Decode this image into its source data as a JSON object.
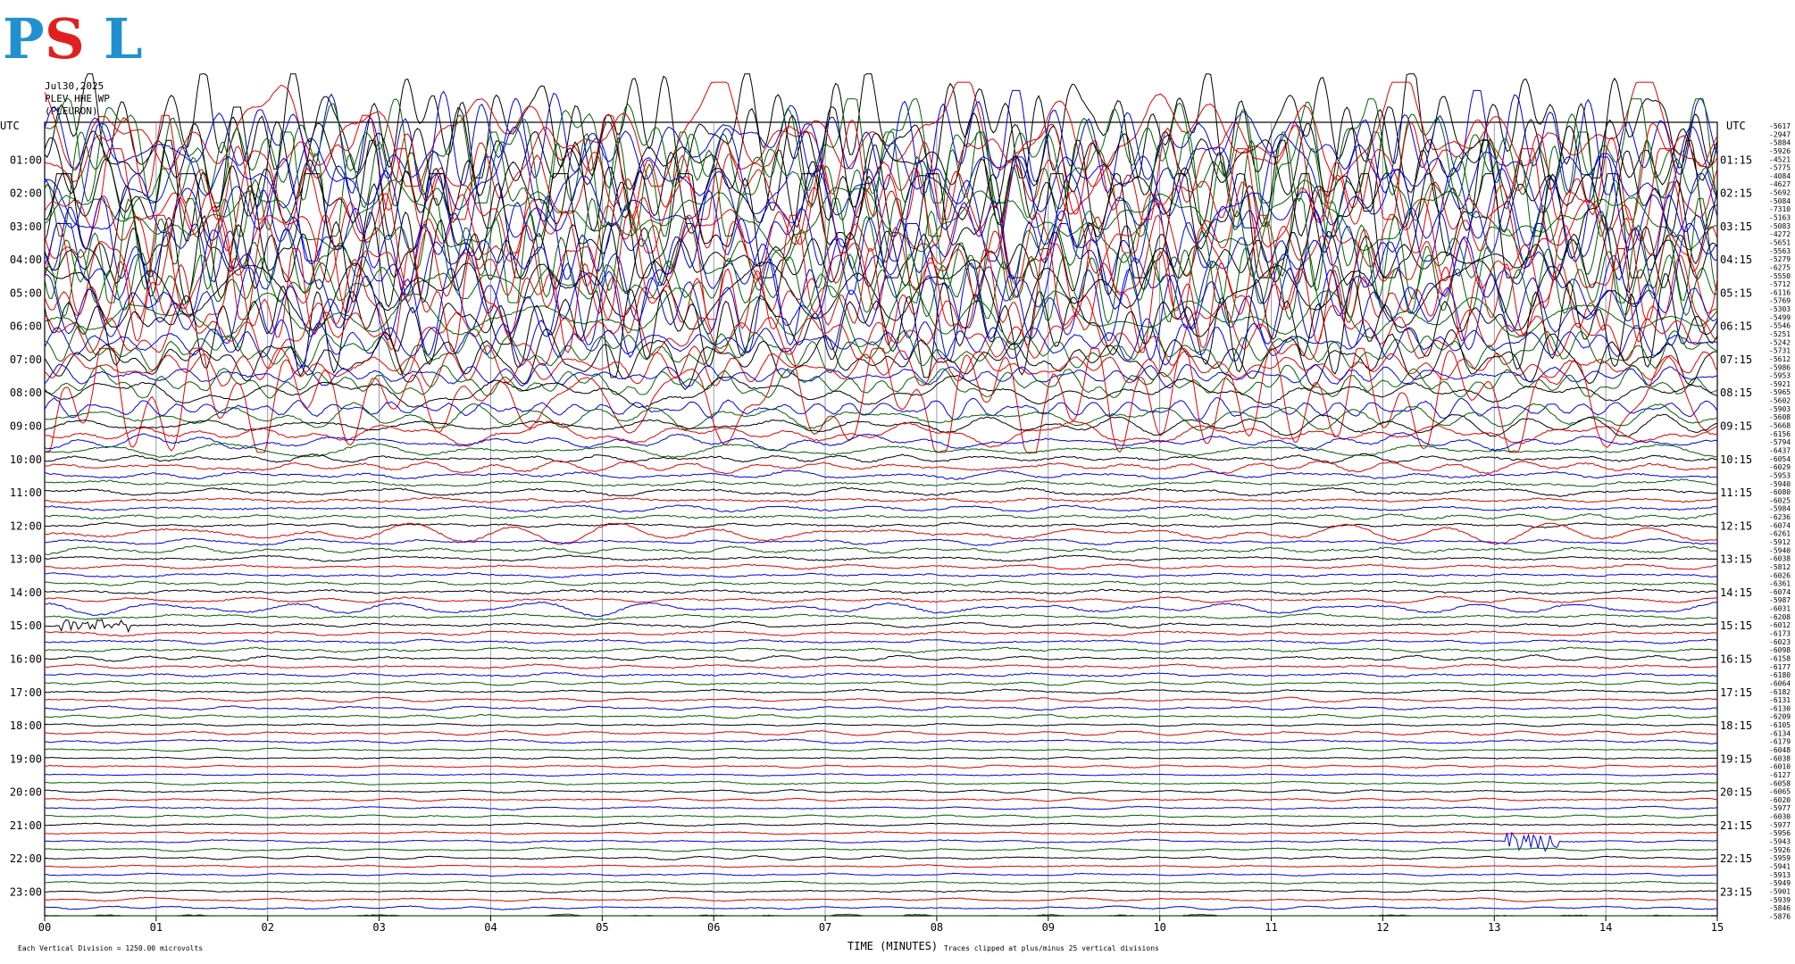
{
  "header": {
    "logo_text": "PSL",
    "date": "Jul30,2025",
    "station": "PLEV HHE WP",
    "site": "(PLEURON)"
  },
  "axes": {
    "left_tz": "UTC",
    "right_tz": "UTC",
    "xlabel": "TIME (MINUTES)",
    "x_ticks": [
      "00",
      "01",
      "02",
      "03",
      "04",
      "05",
      "06",
      "07",
      "08",
      "09",
      "10",
      "11",
      "12",
      "13",
      "14",
      "15"
    ],
    "left_hour_labels": [
      "01:00",
      "02:00",
      "03:00",
      "04:00",
      "05:00",
      "06:00",
      "07:00",
      "08:00",
      "09:00",
      "10:00",
      "11:00",
      "12:00",
      "13:00",
      "14:00",
      "15:00",
      "16:00",
      "17:00",
      "18:00",
      "19:00",
      "20:00",
      "21:00",
      "22:00",
      "23:00"
    ],
    "right_hour_labels": [
      "01:15",
      "02:15",
      "03:15",
      "04:15",
      "05:15",
      "06:15",
      "07:15",
      "08:15",
      "09:15",
      "10:15",
      "11:15",
      "12:15",
      "13:15",
      "14:15",
      "15:15",
      "16:15",
      "17:15",
      "18:15",
      "19:15",
      "20:15",
      "21:15",
      "22:15",
      "23:15"
    ]
  },
  "footer": {
    "scale_note": "Each Vertical Division = 1250.00 microvolts",
    "clip_note": "Traces clipped at plus/minus 25 vertical divisions"
  },
  "colors": {
    "trace_cycle": [
      "#000000",
      "#e00000",
      "#0000e0",
      "#006000"
    ],
    "grid": "#8080a0",
    "logo_blue": "#2090d0",
    "logo_red": "#e02020"
  },
  "chart_data": {
    "type": "line",
    "title": "",
    "xlabel": "TIME (MINUTES)",
    "ylabel": "",
    "xlim": [
      0,
      15
    ],
    "trace_minutes": 15,
    "trace_count": 96,
    "offset_labels": [
      -5617,
      -2947,
      -5884,
      -5926,
      -4521,
      -5775,
      -4084,
      -4627,
      -5692,
      -5084,
      -7310,
      -5163,
      -5083,
      -4272,
      -5651,
      -5563,
      -5279,
      -6275,
      -5550,
      -5712,
      -6116,
      -5769,
      -5303,
      -5499,
      -5546,
      -5251,
      -5242,
      -5731,
      -5612,
      -5986,
      -5953,
      -5921,
      -5965,
      -5602,
      -5903,
      -5608,
      -5668,
      -6156,
      -5794,
      -6437,
      -6054,
      -6029,
      -5953,
      -5940,
      -6080,
      -6025,
      -5984,
      -6236,
      -6074,
      -6261,
      -5912,
      -5940,
      -6038,
      -5812,
      -6026,
      -6361,
      -6074,
      -5987,
      -6031,
      -6208,
      -6012,
      -6173,
      -6023,
      -6098,
      -6158,
      -6177,
      -6180,
      -6064,
      -6182,
      -6131,
      -6130,
      -6209,
      -6105,
      -6134,
      -6179,
      -6048,
      -6038,
      -6010,
      -6127,
      -6058,
      -6065,
      -6020,
      -5977,
      -6030,
      -5977,
      -5956,
      -5943,
      -5926,
      -5959,
      -5941,
      -5913,
      -5949,
      -5901,
      -5939,
      -5846,
      -5876
    ],
    "trace_amplitude_divisions": [
      25,
      25,
      25,
      25,
      25,
      25,
      25,
      25,
      25,
      25,
      25,
      25,
      25,
      25,
      25,
      25,
      25,
      25,
      25,
      25,
      22,
      25,
      18,
      12,
      25,
      14,
      10,
      8,
      12,
      7,
      6,
      6,
      5,
      25,
      6,
      5,
      4,
      4,
      3,
      3,
      2,
      2.5,
      2,
      2,
      1.5,
      1.5,
      1.2,
      1.5,
      1,
      3.5,
      1,
      1.5,
      1,
      1,
      1,
      1,
      1.2,
      1,
      3.5,
      1,
      1,
      1,
      1,
      1,
      1,
      1,
      1,
      0.8,
      0.8,
      0.8,
      0.8,
      0.8,
      0.6,
      0.8,
      0.8,
      0.6,
      0.6,
      0.6,
      0.6,
      0.6,
      0.6,
      0.6,
      0.6,
      0.6,
      0.6,
      0.6,
      0.6,
      0.6,
      0.6,
      0.6,
      0.6,
      0.6,
      0.6,
      0.6,
      0.6,
      0.6
    ],
    "events": [
      {
        "trace_time": "15:00",
        "start_min": 0.15,
        "end_min": 0.8,
        "amplitude_div": 0.8
      },
      {
        "trace_time": "21:30",
        "start_min": 13.1,
        "end_min": 13.6,
        "amplitude_div": 1.2
      }
    ],
    "clip_divisions": 25,
    "microvolts_per_division": 1250.0
  }
}
